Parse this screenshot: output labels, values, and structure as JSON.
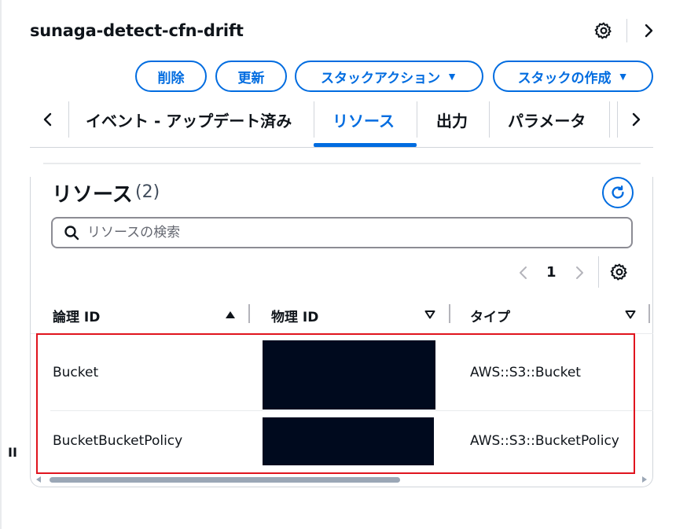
{
  "stack": {
    "title": "sunaga-detect-cfn-drift"
  },
  "actions": {
    "delete": "削除",
    "update": "更新",
    "stack_actions": "スタックアクション",
    "create_stack": "スタックの作成"
  },
  "tabs": [
    {
      "label": "イベント - アップデート済み"
    },
    {
      "label": "リソース",
      "active": true
    },
    {
      "label": "出力"
    },
    {
      "label": "パラメータ"
    }
  ],
  "resources": {
    "heading": "リソース",
    "count": "(2)",
    "search_placeholder": "リソースの検索",
    "page": "1",
    "columns": [
      "論理 ID",
      "物理 ID",
      "タイプ"
    ],
    "rows": [
      {
        "logical_id": "Bucket",
        "type": "AWS::S3::Bucket"
      },
      {
        "logical_id": "BucketBucketPolicy",
        "type": "AWS::S3::BucketPolicy"
      }
    ]
  },
  "drag_handle": "II",
  "colors": {
    "accent": "#006ce0",
    "highlight": "#e0141e",
    "redaction": "#000a1e"
  },
  "icons": [
    "settings-gear-icon",
    "chevron-right-icon",
    "chevron-left-icon",
    "caret-down-icon",
    "refresh-icon",
    "search-icon",
    "sort-ascending-icon",
    "sort-descending-icon"
  ]
}
